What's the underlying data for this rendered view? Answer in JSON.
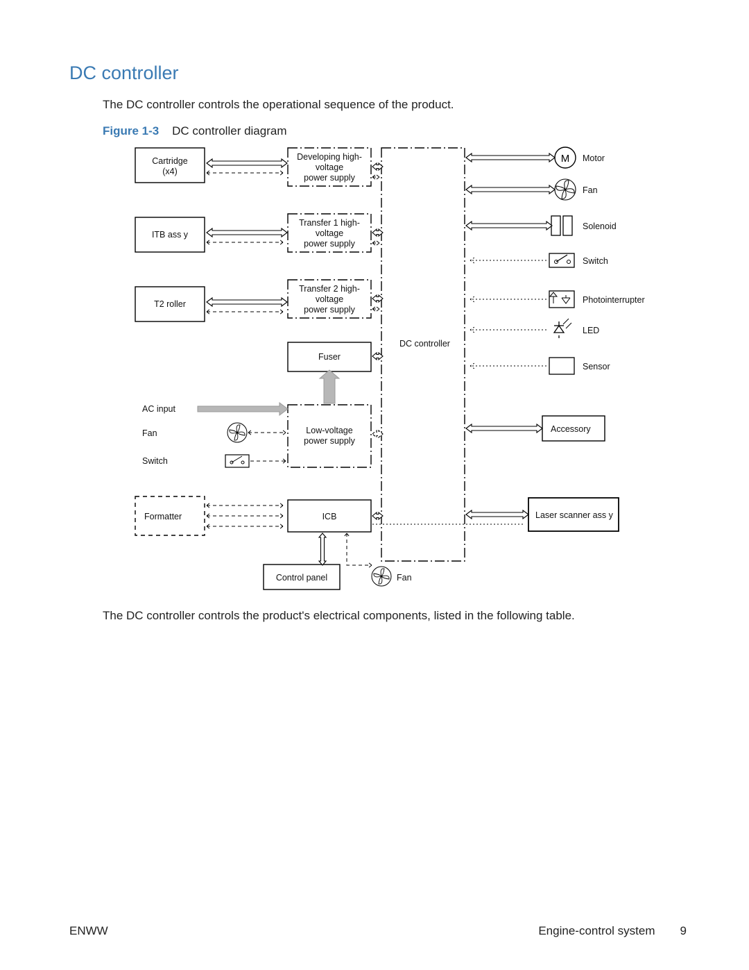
{
  "heading": "DC controller",
  "para1": "The DC controller controls the operational sequence of the product.",
  "figure_prefix": "Figure 1-3",
  "figure_title": "DC controller diagram",
  "para2": "The DC controller controls the product's electrical components, listed in the following table.",
  "footer": {
    "left": "ENWW",
    "section": "Engine-control system",
    "page": "9"
  },
  "diagram": {
    "left_boxes": [
      {
        "id": "cartridge",
        "label": "Cartridge\n(x4)"
      },
      {
        "id": "itb",
        "label": "ITB ass y"
      },
      {
        "id": "t2",
        "label": "T2 roller"
      }
    ],
    "mid_boxes": [
      {
        "id": "dhv",
        "label": "Developing high-\nvoltage\npower supply"
      },
      {
        "id": "t1hv",
        "label": "Transfer 1 high-\nvoltage\npower supply"
      },
      {
        "id": "t2hv",
        "label": "Transfer 2 high-\nvoltage\npower supply"
      },
      {
        "id": "fuser",
        "label": "Fuser"
      },
      {
        "id": "lvps",
        "label": "Low-voltage\npower supply"
      },
      {
        "id": "icb",
        "label": "ICB"
      },
      {
        "id": "cpanel",
        "label": "Control panel"
      }
    ],
    "center_label": "DC controller",
    "left_items": [
      {
        "id": "acinput",
        "label": "AC input"
      },
      {
        "id": "fan",
        "label": "Fan"
      },
      {
        "id": "switch",
        "label": "Switch"
      },
      {
        "id": "formatter",
        "label": "Formatter"
      }
    ],
    "bottom_fan": "Fan",
    "right_items": [
      {
        "id": "motor",
        "label": "Motor",
        "icon": "M"
      },
      {
        "id": "rfan",
        "label": "Fan"
      },
      {
        "id": "solenoid",
        "label": "Solenoid"
      },
      {
        "id": "rswitch",
        "label": "Switch"
      },
      {
        "id": "photo",
        "label": "Photointerrupter"
      },
      {
        "id": "led",
        "label": "LED"
      },
      {
        "id": "sensor",
        "label": "Sensor"
      },
      {
        "id": "accessory",
        "label": "Accessory"
      },
      {
        "id": "laser",
        "label": "Laser scanner ass y"
      }
    ]
  }
}
